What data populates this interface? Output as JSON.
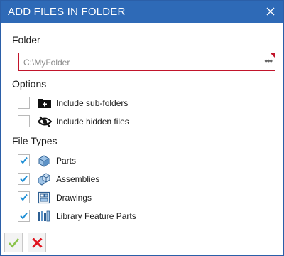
{
  "window": {
    "title": "ADD FILES IN FOLDER"
  },
  "folder": {
    "label": "Folder",
    "value": "C:\\MyFolder",
    "browse_label": "•••"
  },
  "options": {
    "label": "Options",
    "items": [
      {
        "label": "Include sub-folders",
        "checked": false,
        "icon": "add-folder-icon"
      },
      {
        "label": "Include hidden files",
        "checked": false,
        "icon": "hidden-eye-icon"
      }
    ]
  },
  "file_types": {
    "label": "File Types",
    "items": [
      {
        "label": "Parts",
        "checked": true,
        "icon": "part-icon"
      },
      {
        "label": "Assemblies",
        "checked": true,
        "icon": "assembly-icon"
      },
      {
        "label": "Drawings",
        "checked": true,
        "icon": "drawing-icon"
      },
      {
        "label": "Library Feature Parts",
        "checked": true,
        "icon": "library-feature-part-icon"
      }
    ]
  },
  "colors": {
    "title_bar": "#2e6ab7",
    "check": "#1e8fd6",
    "error_border": "#c2152b",
    "ok_green": "#8bc34a",
    "cancel_red": "#e0141e"
  }
}
